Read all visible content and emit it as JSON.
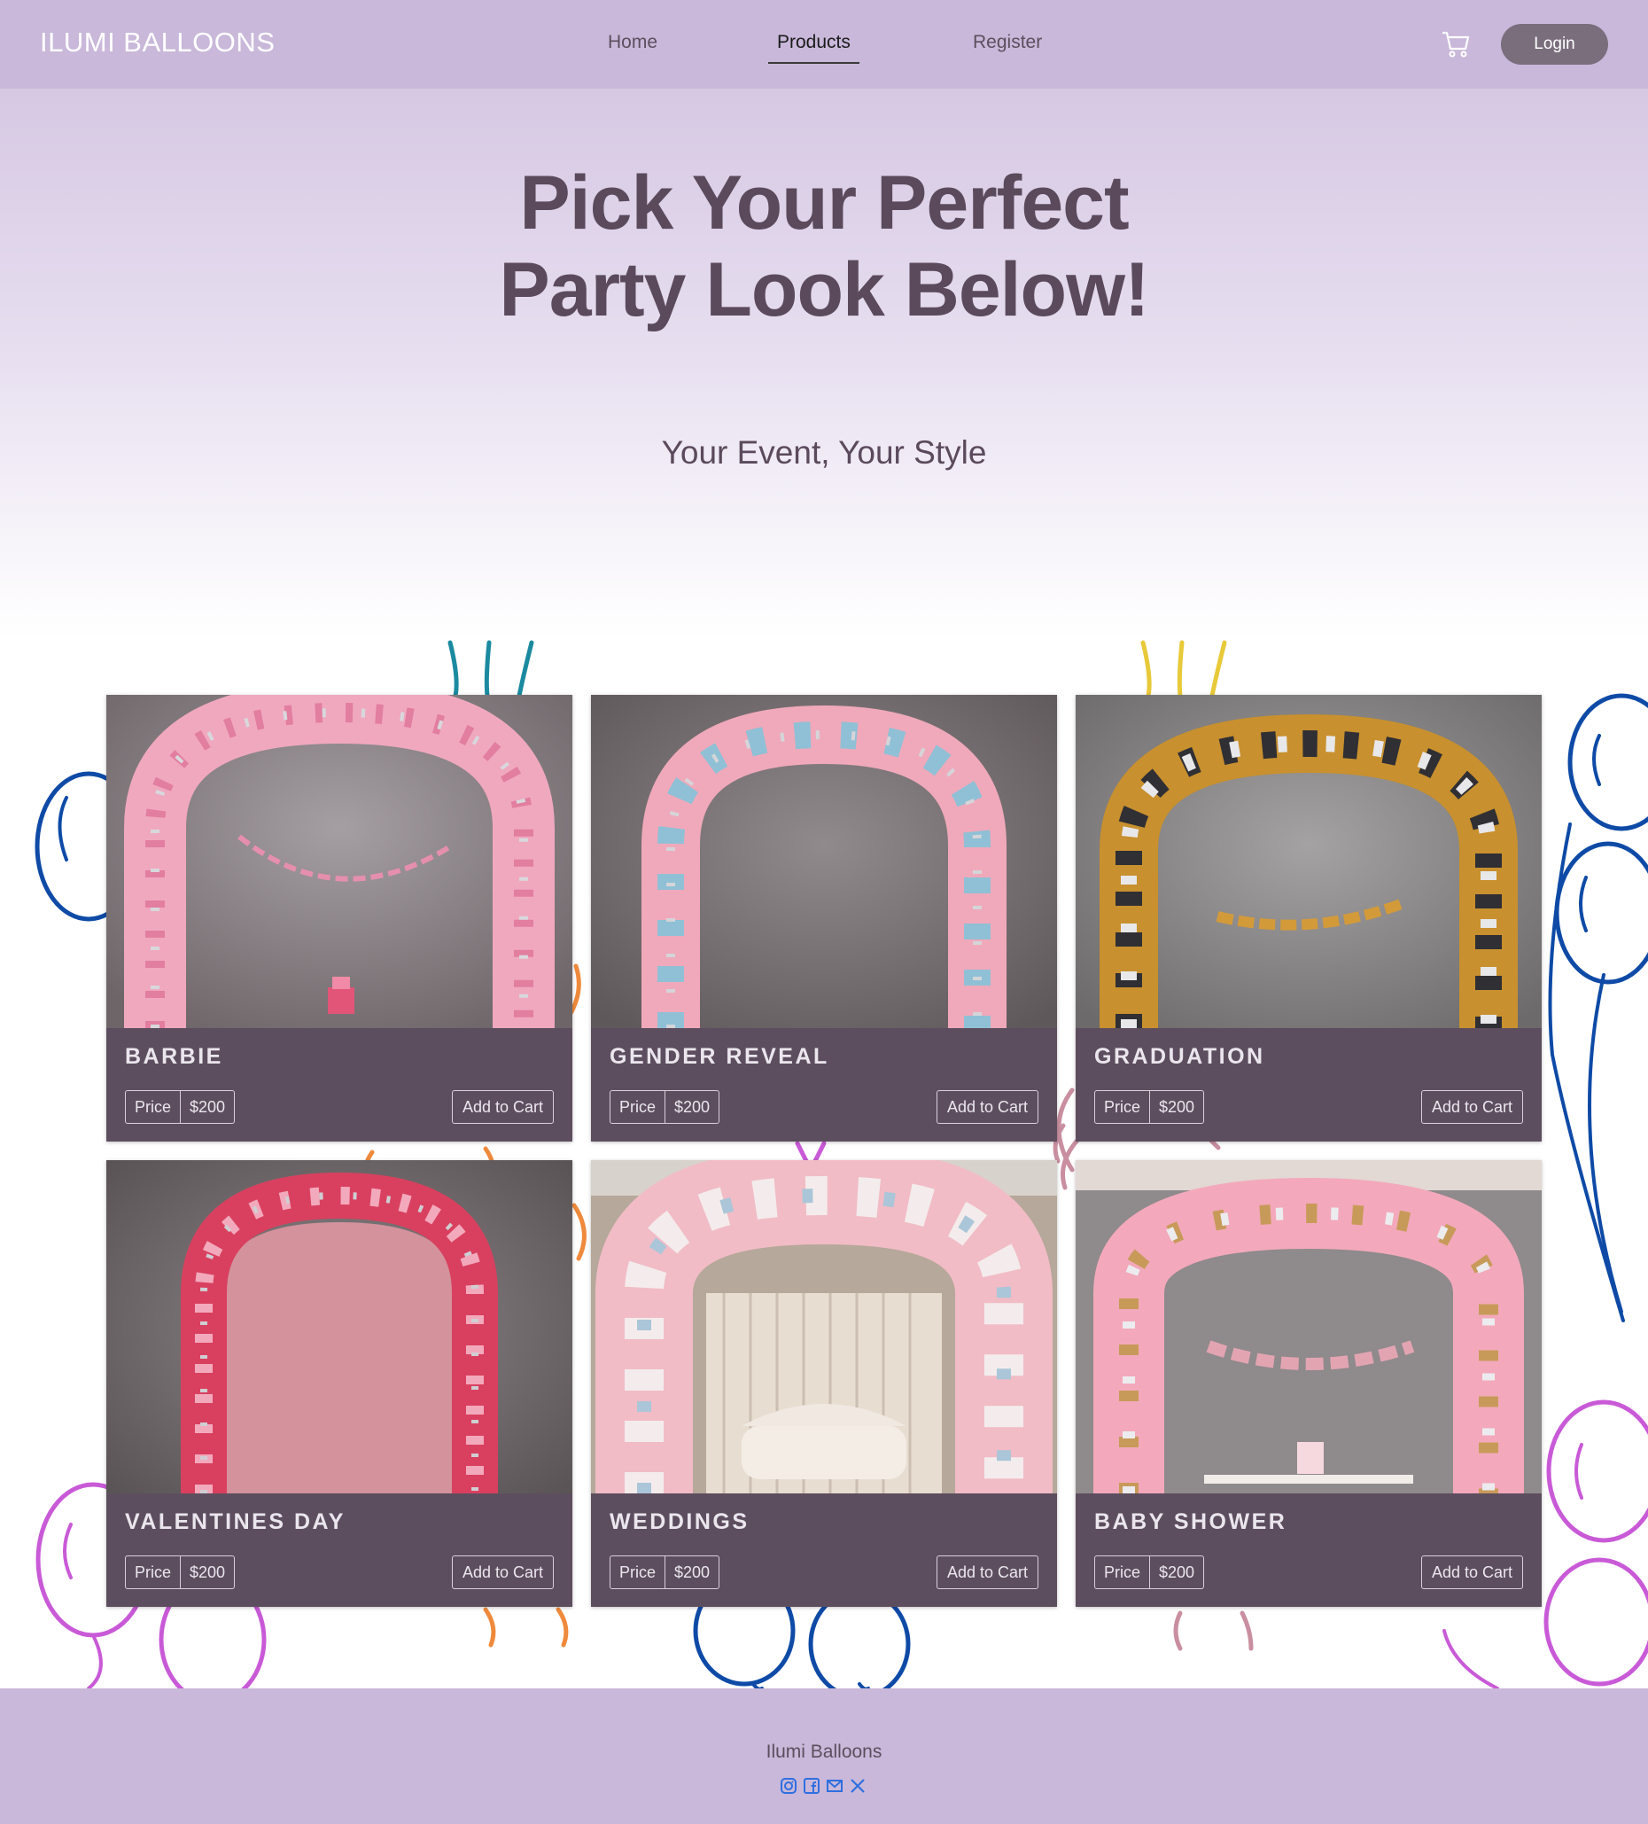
{
  "brand": "ILUMI BALLOONS",
  "nav": {
    "items": [
      {
        "label": "Home",
        "active": false
      },
      {
        "label": "Products",
        "active": true
      },
      {
        "label": "Register",
        "active": false
      }
    ],
    "cart_icon": "cart-icon",
    "login_label": "Login"
  },
  "hero": {
    "title_line1": "Pick Your Perfect",
    "title_line2": "Party Look Below!",
    "subtitle": "Your Event, Your Style"
  },
  "products": [
    {
      "title": "BARBIE",
      "price_label": "Price",
      "price": "$200",
      "button": "Add to Cart",
      "banner": "",
      "palette": "pink"
    },
    {
      "title": "GENDER REVEAL",
      "price_label": "Price",
      "price": "$200",
      "button": "Add to Cart",
      "banner": "",
      "palette": "pinkblue"
    },
    {
      "title": "GRADUATION",
      "price_label": "Price",
      "price": "$200",
      "button": "Add to Cart",
      "banner": "",
      "palette": "goldblack"
    },
    {
      "title": "VALENTINES DAY",
      "price_label": "Price",
      "price": "$200",
      "button": "Add to Cart",
      "banner": "",
      "palette": "red"
    },
    {
      "title": "WEDDINGS",
      "price_label": "Price",
      "price": "$200",
      "button": "Add to Cart",
      "banner": "",
      "palette": "white"
    },
    {
      "title": "BABY SHOWER",
      "price_label": "Price",
      "price": "$200",
      "button": "Add to Cart",
      "banner": "",
      "palette": "pinkgold"
    }
  ],
  "footer": {
    "name": "Ilumi Balloons",
    "social_icons": [
      "instagram-icon",
      "facebook-icon",
      "email-icon",
      "x-icon"
    ]
  },
  "colors": {
    "nav_bg": "#c9b8da",
    "card_bg": "#5d4e5f",
    "hero_text": "#5b4a5c",
    "login_bg": "#7a6e7d"
  }
}
